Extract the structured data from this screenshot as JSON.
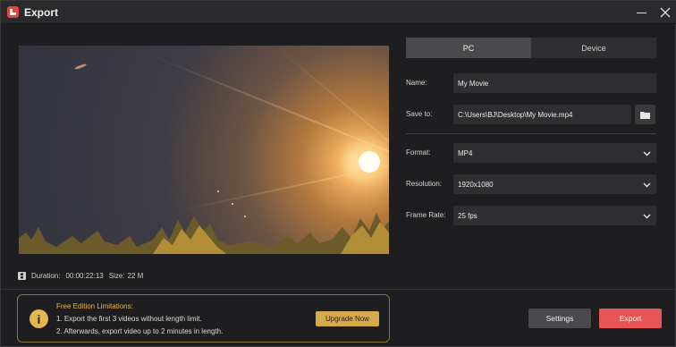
{
  "window": {
    "title": "Export"
  },
  "preview": {
    "duration_label": "Duration:",
    "duration_value": "00:00:22:13",
    "size_label": "Size:",
    "size_value": "22 M"
  },
  "tabs": [
    {
      "label": "PC",
      "active": true
    },
    {
      "label": "Device",
      "active": false
    }
  ],
  "form": {
    "name_label": "Name:",
    "name_value": "My Movie",
    "save_label": "Save to:",
    "save_value": "C:\\Users\\BJ\\Desktop\\My Movie.mp4",
    "format_label": "Format:",
    "format_value": "MP4",
    "resolution_label": "Resolution:",
    "resolution_value": "1920x1080",
    "framerate_label": "Frame Rate:",
    "framerate_value": "25 fps"
  },
  "limitations": {
    "title": "Free Edition Limitations:",
    "line1": "1. Export the first 3 videos without length limit.",
    "line2": "2. Afterwards, export video up to 2 minutes in length.",
    "upgrade_label": "Upgrade Now"
  },
  "actions": {
    "settings_label": "Settings",
    "export_label": "Export"
  },
  "icons": {
    "app": "app-logo-icon",
    "folder": "folder-icon",
    "film": "film-icon",
    "warning": "info-icon"
  },
  "colors": {
    "accent": "#e95454",
    "warning": "#e2b94a",
    "upgrade": "#d6a94a"
  }
}
